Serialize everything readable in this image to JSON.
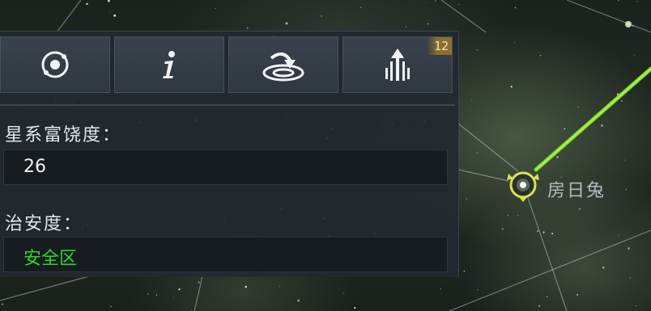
{
  "toolbar": {
    "buttons": [
      {
        "id": "orbit",
        "icon": "orbit-icon"
      },
      {
        "id": "info",
        "icon": "info-icon"
      },
      {
        "id": "jump",
        "icon": "warp-jump-icon"
      },
      {
        "id": "signal",
        "icon": "signal-tower-icon",
        "badge": "12"
      }
    ]
  },
  "info": {
    "richness_label": "星系富饶度：",
    "richness_value": "26",
    "security_label": "治安度：",
    "security_value": "安全区"
  },
  "map": {
    "selected_system_name": "房日兔"
  },
  "colors": {
    "security_safe": "#2fd62a",
    "route_line": "#7fe02a",
    "selection_ring": "#d9e05a",
    "badge_bg": "#9a7430"
  }
}
